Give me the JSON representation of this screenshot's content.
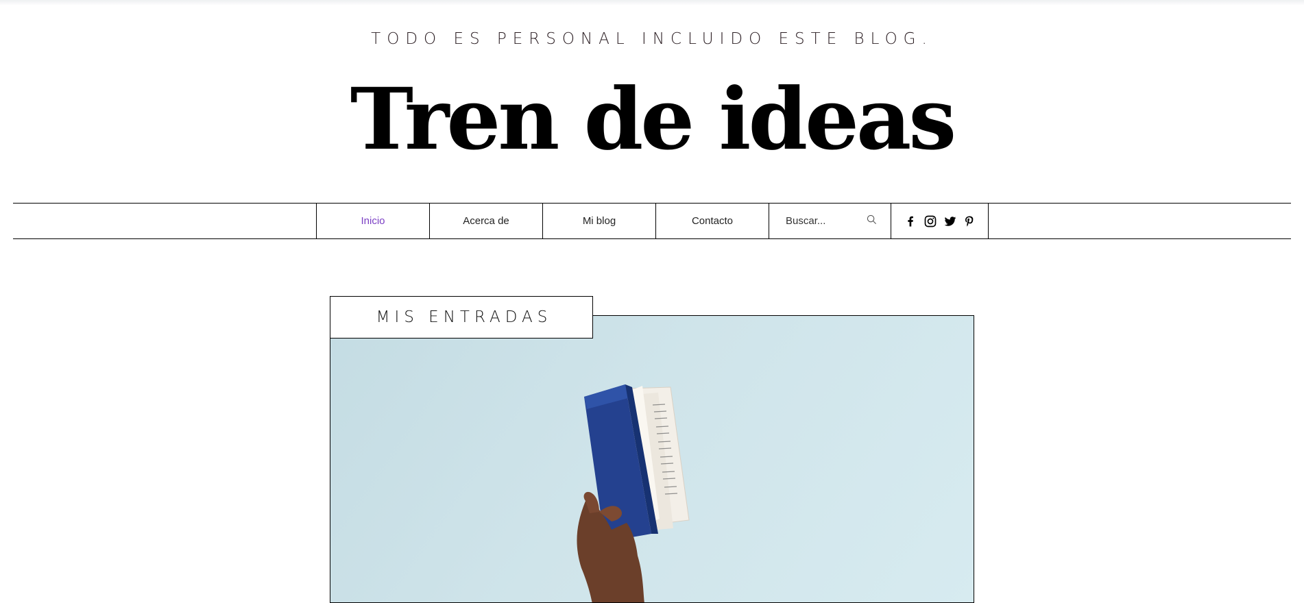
{
  "header": {
    "tagline": "TODO ES PERSONAL INCLUIDO ESTE BLOG.",
    "title": "Tren de ideas"
  },
  "nav": {
    "items": [
      {
        "label": "Inicio",
        "active": true
      },
      {
        "label": "Acerca de",
        "active": false
      },
      {
        "label": "Mi blog",
        "active": false
      },
      {
        "label": "Contacto",
        "active": false
      }
    ],
    "search_placeholder": "Buscar...",
    "social": [
      "facebook-icon",
      "instagram-icon",
      "twitter-icon",
      "pinterest-icon"
    ],
    "active_color": "#7b3fc4"
  },
  "main": {
    "section_label": "MIS ENTRADAS",
    "hero_image": "hand-holding-blue-book",
    "hero_bg_color": "#cfe4ea"
  }
}
